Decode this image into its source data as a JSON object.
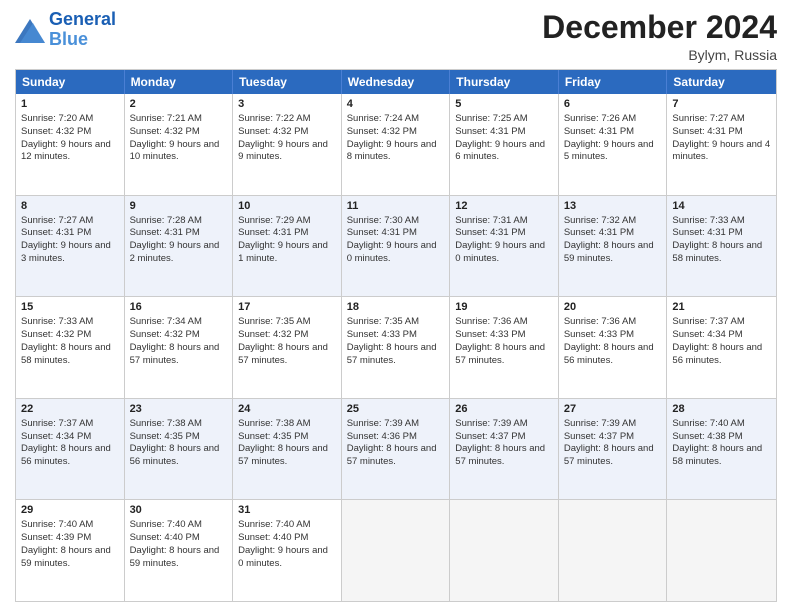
{
  "header": {
    "logo_line1": "General",
    "logo_line2": "Blue",
    "main_title": "December 2024",
    "subtitle": "Bylym, Russia"
  },
  "calendar": {
    "headers": [
      "Sunday",
      "Monday",
      "Tuesday",
      "Wednesday",
      "Thursday",
      "Friday",
      "Saturday"
    ],
    "rows": [
      [
        {
          "day": "1",
          "sunrise": "Sunrise: 7:20 AM",
          "sunset": "Sunset: 4:32 PM",
          "daylight": "Daylight: 9 hours and 12 minutes."
        },
        {
          "day": "2",
          "sunrise": "Sunrise: 7:21 AM",
          "sunset": "Sunset: 4:32 PM",
          "daylight": "Daylight: 9 hours and 10 minutes."
        },
        {
          "day": "3",
          "sunrise": "Sunrise: 7:22 AM",
          "sunset": "Sunset: 4:32 PM",
          "daylight": "Daylight: 9 hours and 9 minutes."
        },
        {
          "day": "4",
          "sunrise": "Sunrise: 7:24 AM",
          "sunset": "Sunset: 4:32 PM",
          "daylight": "Daylight: 9 hours and 8 minutes."
        },
        {
          "day": "5",
          "sunrise": "Sunrise: 7:25 AM",
          "sunset": "Sunset: 4:31 PM",
          "daylight": "Daylight: 9 hours and 6 minutes."
        },
        {
          "day": "6",
          "sunrise": "Sunrise: 7:26 AM",
          "sunset": "Sunset: 4:31 PM",
          "daylight": "Daylight: 9 hours and 5 minutes."
        },
        {
          "day": "7",
          "sunrise": "Sunrise: 7:27 AM",
          "sunset": "Sunset: 4:31 PM",
          "daylight": "Daylight: 9 hours and 4 minutes."
        }
      ],
      [
        {
          "day": "8",
          "sunrise": "Sunrise: 7:27 AM",
          "sunset": "Sunset: 4:31 PM",
          "daylight": "Daylight: 9 hours and 3 minutes."
        },
        {
          "day": "9",
          "sunrise": "Sunrise: 7:28 AM",
          "sunset": "Sunset: 4:31 PM",
          "daylight": "Daylight: 9 hours and 2 minutes."
        },
        {
          "day": "10",
          "sunrise": "Sunrise: 7:29 AM",
          "sunset": "Sunset: 4:31 PM",
          "daylight": "Daylight: 9 hours and 1 minute."
        },
        {
          "day": "11",
          "sunrise": "Sunrise: 7:30 AM",
          "sunset": "Sunset: 4:31 PM",
          "daylight": "Daylight: 9 hours and 0 minutes."
        },
        {
          "day": "12",
          "sunrise": "Sunrise: 7:31 AM",
          "sunset": "Sunset: 4:31 PM",
          "daylight": "Daylight: 9 hours and 0 minutes."
        },
        {
          "day": "13",
          "sunrise": "Sunrise: 7:32 AM",
          "sunset": "Sunset: 4:31 PM",
          "daylight": "Daylight: 8 hours and 59 minutes."
        },
        {
          "day": "14",
          "sunrise": "Sunrise: 7:33 AM",
          "sunset": "Sunset: 4:31 PM",
          "daylight": "Daylight: 8 hours and 58 minutes."
        }
      ],
      [
        {
          "day": "15",
          "sunrise": "Sunrise: 7:33 AM",
          "sunset": "Sunset: 4:32 PM",
          "daylight": "Daylight: 8 hours and 58 minutes."
        },
        {
          "day": "16",
          "sunrise": "Sunrise: 7:34 AM",
          "sunset": "Sunset: 4:32 PM",
          "daylight": "Daylight: 8 hours and 57 minutes."
        },
        {
          "day": "17",
          "sunrise": "Sunrise: 7:35 AM",
          "sunset": "Sunset: 4:32 PM",
          "daylight": "Daylight: 8 hours and 57 minutes."
        },
        {
          "day": "18",
          "sunrise": "Sunrise: 7:35 AM",
          "sunset": "Sunset: 4:33 PM",
          "daylight": "Daylight: 8 hours and 57 minutes."
        },
        {
          "day": "19",
          "sunrise": "Sunrise: 7:36 AM",
          "sunset": "Sunset: 4:33 PM",
          "daylight": "Daylight: 8 hours and 57 minutes."
        },
        {
          "day": "20",
          "sunrise": "Sunrise: 7:36 AM",
          "sunset": "Sunset: 4:33 PM",
          "daylight": "Daylight: 8 hours and 56 minutes."
        },
        {
          "day": "21",
          "sunrise": "Sunrise: 7:37 AM",
          "sunset": "Sunset: 4:34 PM",
          "daylight": "Daylight: 8 hours and 56 minutes."
        }
      ],
      [
        {
          "day": "22",
          "sunrise": "Sunrise: 7:37 AM",
          "sunset": "Sunset: 4:34 PM",
          "daylight": "Daylight: 8 hours and 56 minutes."
        },
        {
          "day": "23",
          "sunrise": "Sunrise: 7:38 AM",
          "sunset": "Sunset: 4:35 PM",
          "daylight": "Daylight: 8 hours and 56 minutes."
        },
        {
          "day": "24",
          "sunrise": "Sunrise: 7:38 AM",
          "sunset": "Sunset: 4:35 PM",
          "daylight": "Daylight: 8 hours and 57 minutes."
        },
        {
          "day": "25",
          "sunrise": "Sunrise: 7:39 AM",
          "sunset": "Sunset: 4:36 PM",
          "daylight": "Daylight: 8 hours and 57 minutes."
        },
        {
          "day": "26",
          "sunrise": "Sunrise: 7:39 AM",
          "sunset": "Sunset: 4:37 PM",
          "daylight": "Daylight: 8 hours and 57 minutes."
        },
        {
          "day": "27",
          "sunrise": "Sunrise: 7:39 AM",
          "sunset": "Sunset: 4:37 PM",
          "daylight": "Daylight: 8 hours and 57 minutes."
        },
        {
          "day": "28",
          "sunrise": "Sunrise: 7:40 AM",
          "sunset": "Sunset: 4:38 PM",
          "daylight": "Daylight: 8 hours and 58 minutes."
        }
      ],
      [
        {
          "day": "29",
          "sunrise": "Sunrise: 7:40 AM",
          "sunset": "Sunset: 4:39 PM",
          "daylight": "Daylight: 8 hours and 59 minutes."
        },
        {
          "day": "30",
          "sunrise": "Sunrise: 7:40 AM",
          "sunset": "Sunset: 4:40 PM",
          "daylight": "Daylight: 8 hours and 59 minutes."
        },
        {
          "day": "31",
          "sunrise": "Sunrise: 7:40 AM",
          "sunset": "Sunset: 4:40 PM",
          "daylight": "Daylight: 9 hours and 0 minutes."
        },
        {
          "day": "",
          "sunrise": "",
          "sunset": "",
          "daylight": ""
        },
        {
          "day": "",
          "sunrise": "",
          "sunset": "",
          "daylight": ""
        },
        {
          "day": "",
          "sunrise": "",
          "sunset": "",
          "daylight": ""
        },
        {
          "day": "",
          "sunrise": "",
          "sunset": "",
          "daylight": ""
        }
      ]
    ]
  }
}
